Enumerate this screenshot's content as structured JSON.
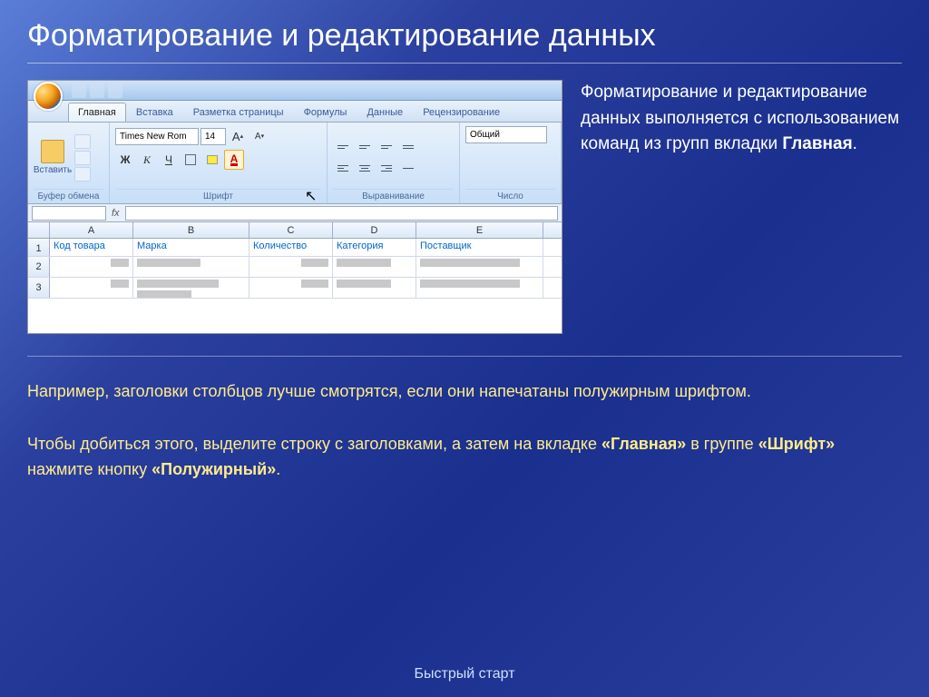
{
  "title": "Форматирование и редактирование данных",
  "side_text": {
    "p1a": "Форматирование и редактирование данных выполняется с использованием команд из групп вкладки ",
    "p1b": "Главная",
    "p1c": "."
  },
  "bottom_text": {
    "l1": "Например, заголовки столбцов лучше смотрятся, если они напечатаны полужирным шрифтом.",
    "l2a": "Чтобы добиться этого, выделите строку с заголовками, а затем на вкладке ",
    "l2b": "«Главная»",
    "l2c": " в группе ",
    "l2d": "«Шрифт»",
    "l2e": " нажмите кнопку ",
    "l2f": "«Полужирный»",
    "l2g": "."
  },
  "footer": "Быстрый старт",
  "ribbon": {
    "tabs": [
      "Главная",
      "Вставка",
      "Разметка страницы",
      "Формулы",
      "Данные",
      "Рецензирование"
    ],
    "groups": {
      "clipboard": "Буфер обмена",
      "font": "Шрифт",
      "alignment": "Выравнивание",
      "number": "Число"
    },
    "paste": "Вставить",
    "font_name": "Times New Rom",
    "font_size": "14",
    "bold": "Ж",
    "italic": "К",
    "underline": "Ч",
    "number_format": "Общий",
    "grow_font": "A",
    "shrink_font": "A"
  },
  "sheet": {
    "cols": [
      "A",
      "B",
      "C",
      "D",
      "E"
    ],
    "rows": [
      "1",
      "2",
      "3"
    ],
    "headers": [
      "Код товара",
      "Марка",
      "Количество",
      "Категория",
      "Поставщик"
    ]
  }
}
